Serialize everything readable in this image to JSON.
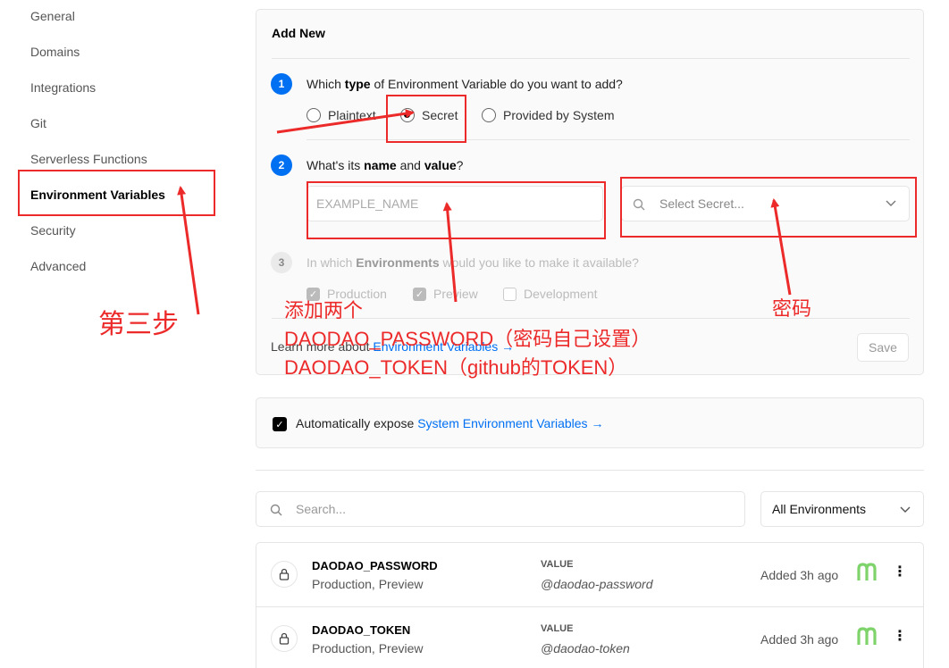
{
  "sidebar": {
    "items": [
      {
        "label": "General"
      },
      {
        "label": "Domains"
      },
      {
        "label": "Integrations"
      },
      {
        "label": "Git"
      },
      {
        "label": "Serverless Functions"
      },
      {
        "label": "Environment Variables",
        "active": true
      },
      {
        "label": "Security"
      },
      {
        "label": "Advanced"
      }
    ]
  },
  "add_new": {
    "title": "Add New",
    "step1": {
      "number": "1",
      "q_before": "Which ",
      "q_bold": "type",
      "q_after": " of Environment Variable do you want to add?",
      "options": [
        "Plaintext",
        "Secret",
        "Provided by System"
      ],
      "selected": "Secret"
    },
    "step2": {
      "number": "2",
      "q_before": "What's its ",
      "q_bold1": "name",
      "q_mid": " and ",
      "q_bold2": "value",
      "q_after": "?",
      "name_placeholder": "EXAMPLE_NAME",
      "secret_placeholder": "Select Secret..."
    },
    "step3": {
      "number": "3",
      "q_before": "In which ",
      "q_bold": "Environments",
      "q_after": " would you like to make it available?",
      "options": [
        {
          "label": "Production",
          "checked": true
        },
        {
          "label": "Preview",
          "checked": true
        },
        {
          "label": "Development",
          "checked": false
        }
      ]
    },
    "learn_prefix": "Learn more about ",
    "learn_link": "Environment Variables →",
    "save_label": "Save"
  },
  "auto_expose": {
    "prefix": "Automatically expose ",
    "link": "System Environment Variables →",
    "checked": true
  },
  "search": {
    "placeholder": "Search..."
  },
  "env_filter": {
    "selected": "All Environments"
  },
  "variables": [
    {
      "name": "DAODAO_PASSWORD",
      "envs": "Production, Preview",
      "value_label": "VALUE",
      "value": "@daodao-password",
      "added": "Added 3h ago"
    },
    {
      "name": "DAODAO_TOKEN",
      "envs": "Production, Preview",
      "value_label": "VALUE",
      "value": "@daodao-token",
      "added": "Added 3h ago"
    }
  ],
  "annotations": {
    "step3_label": "第三步",
    "add_two": "添加两个",
    "line1": "DAODAO_PASSWORD（密码自己设置）",
    "line2": "DAODAO_TOKEN（github的TOKEN）",
    "password_label": "密码"
  },
  "colors": {
    "accent": "#0070f3",
    "annotation": "#ec2a2a",
    "avatar": "#7ed36b"
  }
}
